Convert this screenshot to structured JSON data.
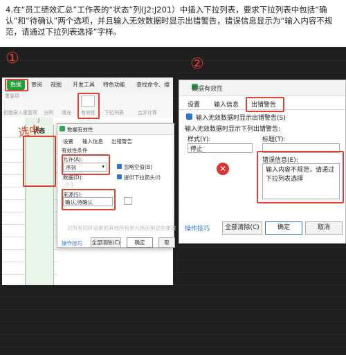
{
  "instruction": {
    "text": "4.在“员工绩效汇总”工作表的“状态”列(J2:J201）中插入下拉列表，要求下拉列表中包括“确认”和“待确认”两个选项，并且输入无效数据时显示出错警告，错误信息显示为“输入内容不规范，请通过下拉列表选择”字样。"
  },
  "annotations": {
    "step1": "①",
    "step2": "②",
    "select_note": "选中"
  },
  "left": {
    "tabs": [
      "数据",
      "审阅",
      "视图",
      "开发工具",
      "特色功能"
    ],
    "search": "查找命令、搜",
    "ribbon_items": [
      "重复项",
      "分列",
      "填充",
      "有效性",
      "下拉列表",
      "合并计算"
    ],
    "ribbon_sub": "拒绝录入重复项",
    "col_header": "J",
    "cell_header": "状态",
    "dialog": {
      "title": "数据有效性",
      "tabs": [
        "设置",
        "输入信息",
        "出错警告"
      ],
      "section": "有效性条件",
      "allow_label": "允许(A):",
      "allow_value": "序列",
      "ignore_blank": "忽略空值(B)",
      "data_label": "数据(D):",
      "data_value": "介于",
      "dropdown": "提供下拉箭头(I)",
      "source_label": "来源(S):",
      "source_value": "确认,待确认",
      "apply_all": "对所有同样设置的其他所有单元格应用这些更改",
      "tips": "操作技巧",
      "clear": "全部清除(C)",
      "ok": "确定",
      "cancel": "取"
    }
  },
  "right": {
    "title": "数据有效性",
    "tabs": [
      "设置",
      "输入信息",
      "出错警告"
    ],
    "show_alert": "输入无效数据时显示出错警告(S)",
    "when_invalid": "输入无效数据时显示下列出错警告:",
    "style_label": "样式(Y):",
    "style_value": "停止",
    "title_label": "标题(T):",
    "error_label": "错误信息(E):",
    "error_message": "输入内容不规范，请通过下拉列表选择",
    "tips": "操作技巧",
    "clear": "全部清除(C)",
    "ok": "确定",
    "cancel": "取消"
  },
  "colors": {
    "accent": "#e0412f",
    "brand": "#1e9f3a",
    "link": "#2f74d0"
  }
}
